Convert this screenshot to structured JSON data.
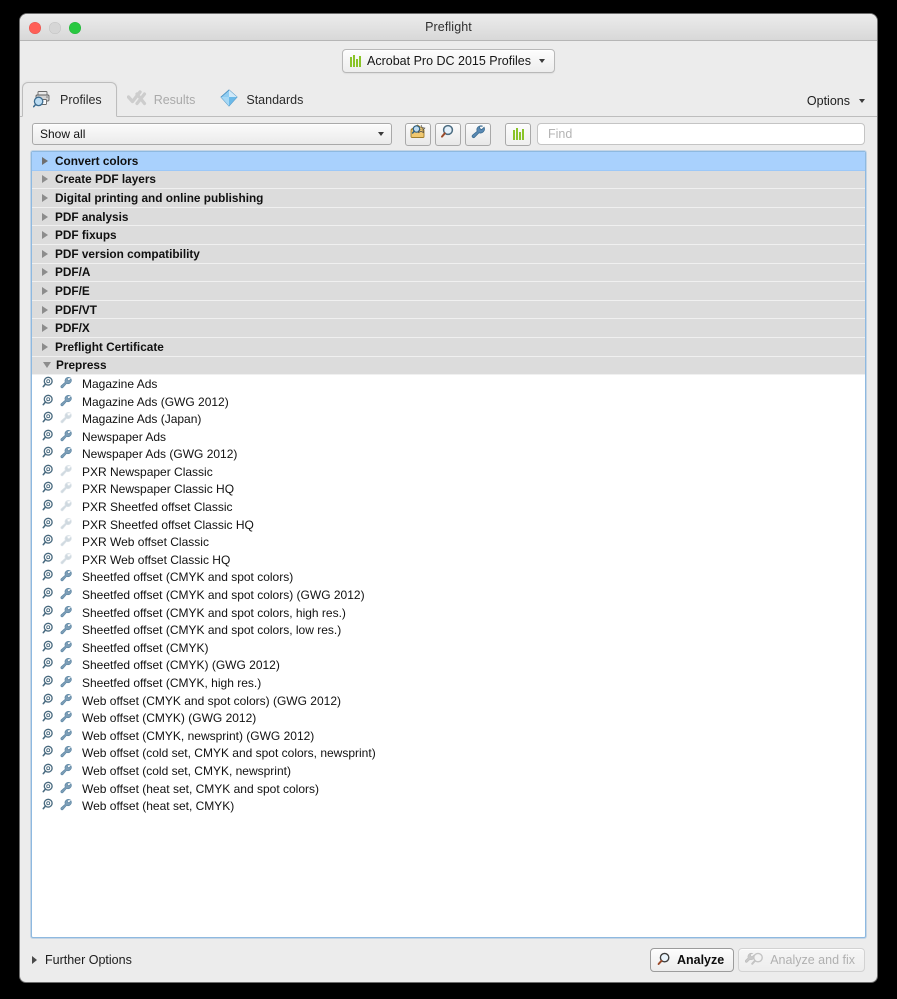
{
  "window": {
    "title": "Preflight",
    "traffic_lights": [
      "close-button",
      "minimize-button",
      "zoom-button"
    ]
  },
  "profile_selector": {
    "label": "Acrobat Pro DC 2015 Profiles",
    "icon": "green-bars-icon"
  },
  "tabs": [
    {
      "label": "Profiles",
      "icon": "printer-magnifier-icon",
      "active": true,
      "disabled": false
    },
    {
      "label": "Results",
      "icon": "checkmark-x-icon",
      "active": false,
      "disabled": true
    },
    {
      "label": "Standards",
      "icon": "blue-diamond-icon",
      "active": false,
      "disabled": false
    }
  ],
  "options_menu": {
    "label": "Options",
    "icon": "chevron-down-icon"
  },
  "toolbar": {
    "filter_value": "Show all",
    "filter_options": [
      "Show all"
    ],
    "buttons": [
      {
        "name": "new-profile-button",
        "icon": "new-profile-icon"
      },
      {
        "name": "inspect-button",
        "icon": "magnifier-icon"
      },
      {
        "name": "fixup-button",
        "icon": "wrench-icon"
      }
    ],
    "bars_button": {
      "name": "profile-set-button",
      "icon": "green-bars-icon"
    },
    "find_placeholder": "Find",
    "find_value": ""
  },
  "categories": [
    {
      "label": "Convert colors",
      "expanded": false,
      "selected": true
    },
    {
      "label": "Create PDF layers",
      "expanded": false,
      "selected": false
    },
    {
      "label": "Digital printing and online publishing",
      "expanded": false,
      "selected": false
    },
    {
      "label": "PDF analysis",
      "expanded": false,
      "selected": false
    },
    {
      "label": "PDF fixups",
      "expanded": false,
      "selected": false
    },
    {
      "label": "PDF version compatibility",
      "expanded": false,
      "selected": false
    },
    {
      "label": "PDF/A",
      "expanded": false,
      "selected": false
    },
    {
      "label": "PDF/E",
      "expanded": false,
      "selected": false
    },
    {
      "label": "PDF/VT",
      "expanded": false,
      "selected": false
    },
    {
      "label": "PDF/X",
      "expanded": false,
      "selected": false
    },
    {
      "label": "Preflight Certificate",
      "expanded": false,
      "selected": false
    },
    {
      "label": "Prepress",
      "expanded": true,
      "selected": false
    }
  ],
  "profiles": [
    {
      "label": "Magazine Ads",
      "fix_enabled": true
    },
    {
      "label": "Magazine Ads (GWG 2012)",
      "fix_enabled": true
    },
    {
      "label": "Magazine Ads (Japan)",
      "fix_enabled": false
    },
    {
      "label": "Newspaper Ads",
      "fix_enabled": true
    },
    {
      "label": "Newspaper Ads (GWG 2012)",
      "fix_enabled": true
    },
    {
      "label": "PXR Newspaper Classic",
      "fix_enabled": false
    },
    {
      "label": "PXR Newspaper Classic HQ",
      "fix_enabled": false
    },
    {
      "label": "PXR Sheetfed offset Classic",
      "fix_enabled": false
    },
    {
      "label": "PXR Sheetfed offset Classic HQ",
      "fix_enabled": false
    },
    {
      "label": "PXR Web offset Classic",
      "fix_enabled": false
    },
    {
      "label": "PXR Web offset Classic HQ",
      "fix_enabled": false
    },
    {
      "label": "Sheetfed offset (CMYK and spot colors)",
      "fix_enabled": true
    },
    {
      "label": "Sheetfed offset (CMYK and spot colors) (GWG 2012)",
      "fix_enabled": true
    },
    {
      "label": "Sheetfed offset (CMYK and spot colors, high res.)",
      "fix_enabled": true
    },
    {
      "label": "Sheetfed offset (CMYK and spot colors, low res.)",
      "fix_enabled": true
    },
    {
      "label": "Sheetfed offset (CMYK)",
      "fix_enabled": true
    },
    {
      "label": "Sheetfed offset (CMYK) (GWG 2012)",
      "fix_enabled": true
    },
    {
      "label": "Sheetfed offset (CMYK, high res.)",
      "fix_enabled": true
    },
    {
      "label": "Web offset (CMYK and spot colors) (GWG 2012)",
      "fix_enabled": true
    },
    {
      "label": "Web offset (CMYK) (GWG 2012)",
      "fix_enabled": true
    },
    {
      "label": "Web offset (CMYK, newsprint) (GWG 2012)",
      "fix_enabled": true
    },
    {
      "label": "Web offset (cold set, CMYK and spot colors, newsprint)",
      "fix_enabled": true
    },
    {
      "label": "Web offset (cold set, CMYK, newsprint)",
      "fix_enabled": true
    },
    {
      "label": "Web offset (heat set, CMYK and spot colors)",
      "fix_enabled": true
    },
    {
      "label": "Web offset (heat set, CMYK)",
      "fix_enabled": true
    }
  ],
  "bottom": {
    "further_options_label": "Further Options",
    "analyze_label": "Analyze",
    "analyze_and_fix_label": "Analyze and fix",
    "analyze_and_fix_disabled": true
  },
  "colors": {
    "selection_blue": "#a9d1fd",
    "category_gray": "#dcdcdc",
    "panel_border_blue": "#8eb9e0",
    "accent_green": "#8ac428",
    "icon_steel": "#7e9fb8",
    "icon_dark": "#4a6b80"
  }
}
